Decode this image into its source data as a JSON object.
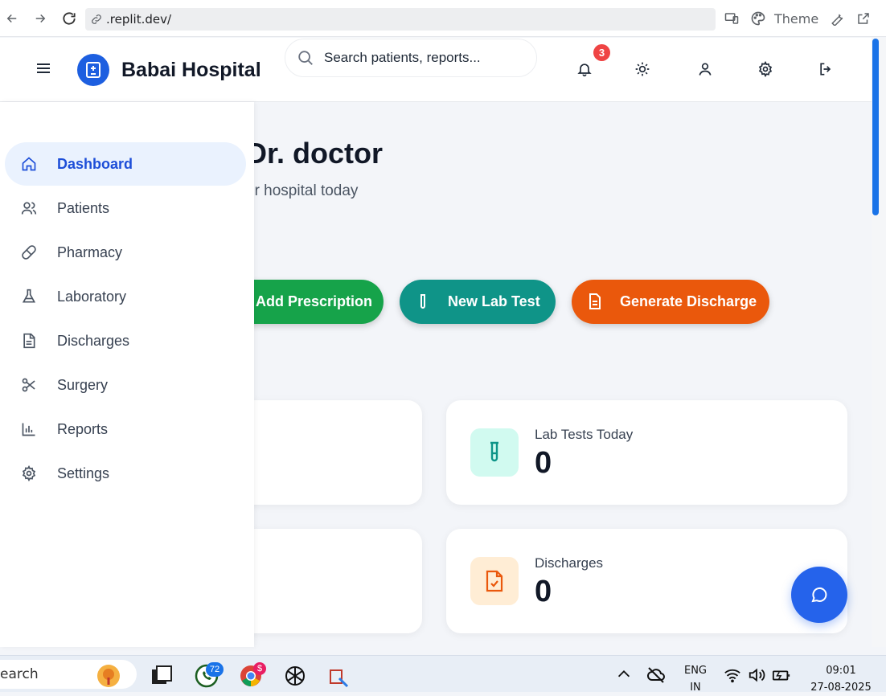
{
  "browser": {
    "url": ".replit.dev/",
    "theme_label": "Theme"
  },
  "header": {
    "brand": "Babai Hospital",
    "search_placeholder": "Search patients, reports...",
    "notification_count": "3"
  },
  "sidebar": {
    "items": [
      {
        "label": "Dashboard",
        "icon": "home-icon",
        "active": true
      },
      {
        "label": "Patients",
        "icon": "users-icon"
      },
      {
        "label": "Pharmacy",
        "icon": "pill-icon"
      },
      {
        "label": "Laboratory",
        "icon": "flask-icon"
      },
      {
        "label": "Discharges",
        "icon": "file-icon"
      },
      {
        "label": "Surgery",
        "icon": "scissors-icon"
      },
      {
        "label": "Reports",
        "icon": "bar-chart-icon"
      },
      {
        "label": "Settings",
        "icon": "gear-icon"
      }
    ]
  },
  "main": {
    "greeting_visible": "Dr. doctor",
    "subtitle_visible": "ur hospital today",
    "actions": [
      {
        "label": "Add Prescription",
        "color": "#16a34a"
      },
      {
        "label": "New Lab Test",
        "color": "#0f9488"
      },
      {
        "label": "Generate Discharge",
        "color": "#ea580c"
      }
    ],
    "stats": [
      {
        "label": "Lab Tests Today",
        "value": "0",
        "icon": "test-tube-icon",
        "icon_bg": "#d1faf0",
        "icon_color": "#0d9488"
      },
      {
        "label": "Discharges",
        "value": "0",
        "icon": "file-check-icon",
        "icon_bg": "#ffedd5",
        "icon_color": "#ea580c"
      }
    ]
  },
  "taskbar": {
    "search_text": "earch",
    "whatsapp_badge": "72",
    "chrome_badge": "$",
    "lang_top": "ENG",
    "lang_bottom": "IN",
    "time": "09:01",
    "date": "27-08-2025"
  },
  "colors": {
    "primary": "#1d5fe0",
    "active_nav_bg": "#eaf2fe",
    "badge_red": "#ef4444"
  }
}
